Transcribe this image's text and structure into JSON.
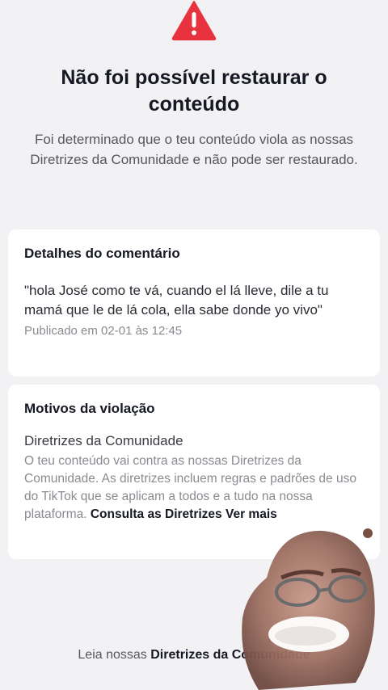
{
  "header": {
    "title": "Não foi possível restaurar o conteúdo",
    "subtitle": "Foi determinado que o teu conteúdo viola as nossas Diretrizes da Comunidade e não pode ser restaurado."
  },
  "comment_details": {
    "title": "Detalhes do comentário",
    "comment_text": "\"hola José como te vá, cuando el lá lleve, dile a tu mamá que le de lá cola, ella sabe donde yo vivo\"",
    "published": "Publicado em 02-01 às 12:45"
  },
  "violation_reasons": {
    "title": "Motivos da violação",
    "rule_name": "Diretrizes da Comunidade",
    "rule_description": "O teu conteúdo vai contra as nossas Diretrizes da Comunidade. As diretrizes incluem regras e padrões de uso do TikTok que se aplicam a todos e a tudo na nossa plataforma.",
    "guidelines_link": "Consulta as Diretrizes",
    "see_more": "Ver mais"
  },
  "footer": {
    "prefix": "Leia nossas",
    "link": "Diretrizes da Comunidade"
  },
  "icons": {
    "warning": "warning-triangle-icon"
  },
  "colors": {
    "warning_red": "#e8333f",
    "background": "#f2f2f4",
    "card": "#ffffff"
  }
}
